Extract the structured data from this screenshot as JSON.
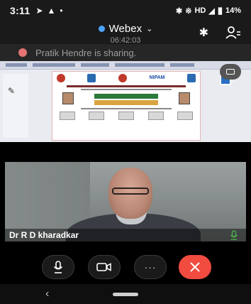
{
  "status_bar": {
    "time": "3:11",
    "network_label": "HD",
    "battery": "14%"
  },
  "header": {
    "app_title": "Webex",
    "timer": "06:42:03"
  },
  "sharing_banner": {
    "text": "Pratik Hendre is sharing."
  },
  "shared_content": {
    "slide_brand": "NIPAM"
  },
  "participant": {
    "name": "Dr R D kharadkar"
  },
  "controls": {
    "more_label": "···"
  },
  "icons": {
    "status": [
      "send-icon",
      "alert-icon",
      "dot-icon",
      "bluetooth-icon",
      "wifi-icon",
      "signal-icon",
      "battery-icon"
    ],
    "header": [
      "chevron-down-icon",
      "bluetooth-icon",
      "participants-icon"
    ],
    "controls": [
      "microphone-icon",
      "camera-icon",
      "more-icon",
      "close-icon"
    ]
  },
  "colors": {
    "leave_button": "#f24b3f",
    "recording_dot": "#e57373",
    "webex_dot": "#4aa3ff",
    "mic_active": "#4caf50"
  }
}
